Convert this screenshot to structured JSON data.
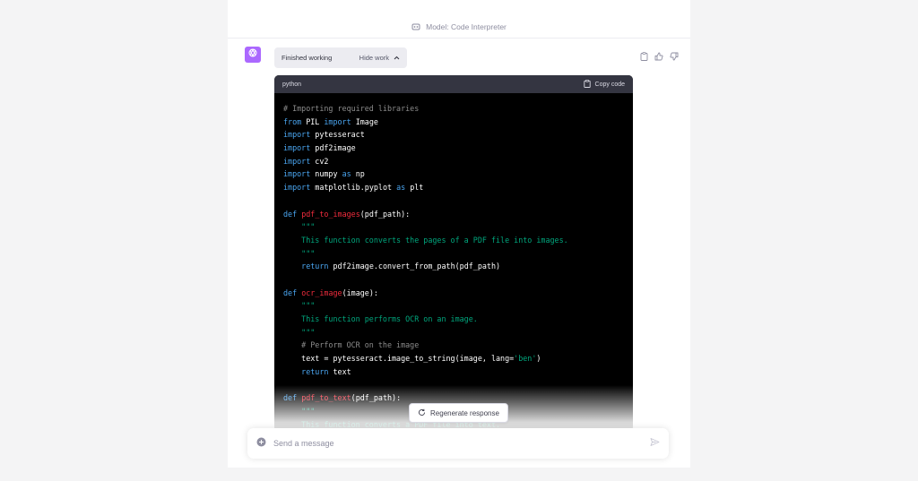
{
  "header": {
    "model_label": "Model: Code Interpreter"
  },
  "message": {
    "status": "Finished working",
    "toggle_label": "Hide work"
  },
  "code_block": {
    "language": "python",
    "copy_label": "Copy code",
    "lines": [
      [
        {
          "t": "cm",
          "v": "# Importing required libraries"
        }
      ],
      [
        {
          "t": "kw",
          "v": "from"
        },
        {
          "t": "tx",
          "v": " PIL "
        },
        {
          "t": "kw",
          "v": "import"
        },
        {
          "t": "tx",
          "v": " Image"
        }
      ],
      [
        {
          "t": "kw",
          "v": "import"
        },
        {
          "t": "tx",
          "v": " pytesseract"
        }
      ],
      [
        {
          "t": "kw",
          "v": "import"
        },
        {
          "t": "tx",
          "v": " pdf2image"
        }
      ],
      [
        {
          "t": "kw",
          "v": "import"
        },
        {
          "t": "tx",
          "v": " cv2"
        }
      ],
      [
        {
          "t": "kw",
          "v": "import"
        },
        {
          "t": "tx",
          "v": " numpy "
        },
        {
          "t": "kw",
          "v": "as"
        },
        {
          "t": "tx",
          "v": " np"
        }
      ],
      [
        {
          "t": "kw",
          "v": "import"
        },
        {
          "t": "tx",
          "v": " matplotlib.pyplot "
        },
        {
          "t": "kw",
          "v": "as"
        },
        {
          "t": "tx",
          "v": " plt"
        }
      ],
      [],
      [
        {
          "t": "kw",
          "v": "def"
        },
        {
          "t": "tx",
          "v": " "
        },
        {
          "t": "fn",
          "v": "pdf_to_images"
        },
        {
          "t": "tx",
          "v": "(pdf_path):"
        }
      ],
      [
        {
          "t": "st",
          "v": "    \"\"\""
        }
      ],
      [
        {
          "t": "st",
          "v": "    This function converts the pages of a PDF file into images."
        }
      ],
      [
        {
          "t": "st",
          "v": "    \"\"\""
        }
      ],
      [
        {
          "t": "tx",
          "v": "    "
        },
        {
          "t": "kw",
          "v": "return"
        },
        {
          "t": "tx",
          "v": " pdf2image.convert_from_path(pdf_path)"
        }
      ],
      [],
      [
        {
          "t": "kw",
          "v": "def"
        },
        {
          "t": "tx",
          "v": " "
        },
        {
          "t": "fn",
          "v": "ocr_image"
        },
        {
          "t": "tx",
          "v": "(image):"
        }
      ],
      [
        {
          "t": "st",
          "v": "    \"\"\""
        }
      ],
      [
        {
          "t": "st",
          "v": "    This function performs OCR on an image."
        }
      ],
      [
        {
          "t": "st",
          "v": "    \"\"\""
        }
      ],
      [
        {
          "t": "cm",
          "v": "    # Perform OCR on the image"
        }
      ],
      [
        {
          "t": "tx",
          "v": "    text = pytesseract.image_to_string(image, lang="
        },
        {
          "t": "st",
          "v": "'ben'"
        },
        {
          "t": "tx",
          "v": ")"
        }
      ],
      [
        {
          "t": "tx",
          "v": "    "
        },
        {
          "t": "kw",
          "v": "return"
        },
        {
          "t": "tx",
          "v": " text"
        }
      ],
      [],
      [
        {
          "t": "kw",
          "v": "def"
        },
        {
          "t": "tx",
          "v": " "
        },
        {
          "t": "fn",
          "v": "pdf_to_text"
        },
        {
          "t": "tx",
          "v": "(pdf_path):"
        }
      ],
      [
        {
          "t": "st",
          "v": "    \"\"\""
        }
      ],
      [
        {
          "t": "st",
          "v": "    This function converts a PDF file into text."
        }
      ]
    ]
  },
  "regenerate": {
    "label": "Regenerate response"
  },
  "composer": {
    "placeholder": "Send a message"
  },
  "colors": {
    "avatar": "#ab68ff",
    "code_bg": "#000000",
    "code_header": "#343541",
    "keyword": "#4aa5f0",
    "function": "#f22c3d",
    "string": "#00a67d",
    "comment": "#8c8c8c"
  },
  "icons": {
    "model": "sparkle-icon",
    "avatar": "openai-logo-icon",
    "toggle": "chevron-up-icon",
    "copy": "clipboard-icon",
    "like": "thumbs-up-icon",
    "dislike": "thumbs-down-icon",
    "regenerate": "refresh-icon",
    "plugin": "plus-circle-icon",
    "send": "paper-plane-icon"
  }
}
